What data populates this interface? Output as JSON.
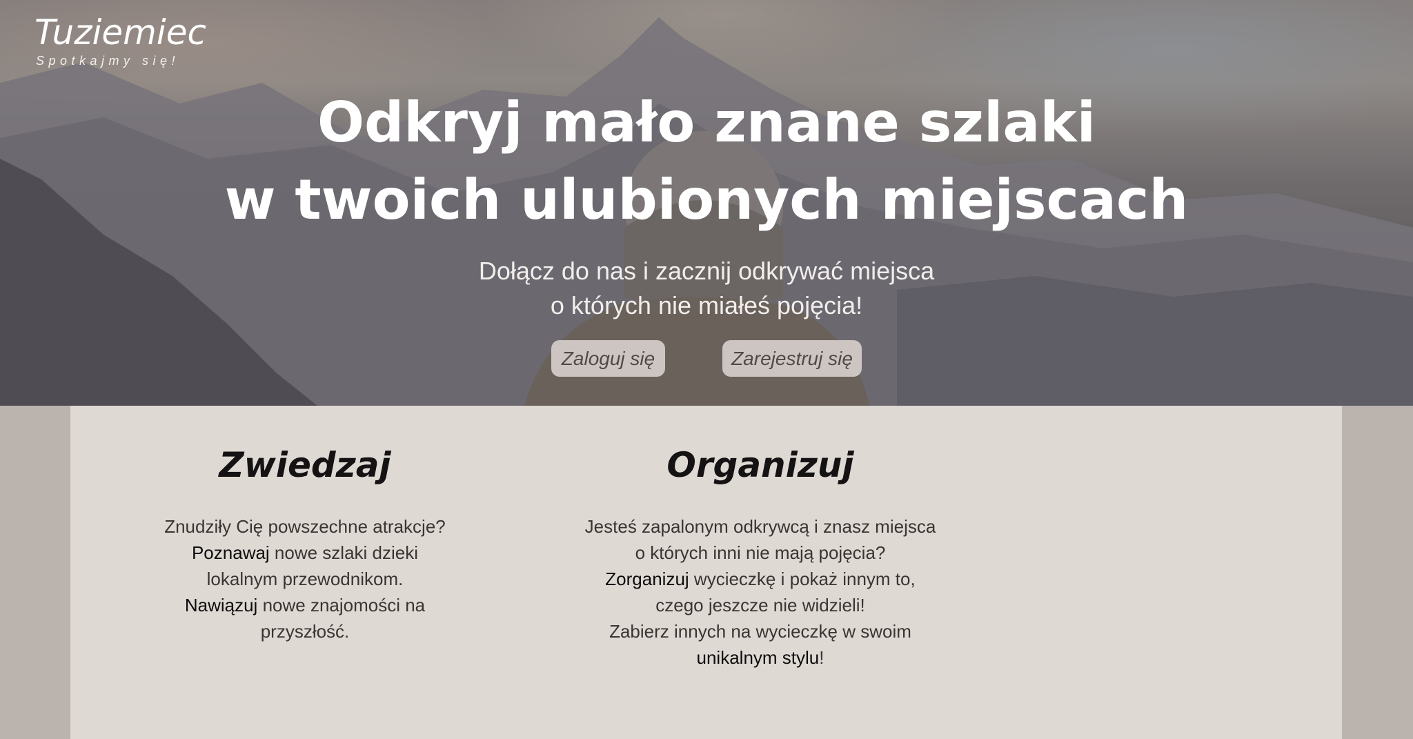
{
  "brand": {
    "title": "Tuziemiec",
    "tagline": "Spotkajmy się!"
  },
  "hero": {
    "heading_line1": "Odkryj mało znane szlaki",
    "heading_line2": "w twoich ulubionych miejscach",
    "subtitle_line1": "Dołącz do nas i zacznij odkrywać miejsca",
    "subtitle_line2": "o których nie miałeś pojęcia!",
    "login_label": "Zaloguj się",
    "register_label": "Zarejestruj się"
  },
  "explore": {
    "title": "Zwiedzaj",
    "line1": "Znudziły Cię powszechne atrakcje?",
    "line2_bold": "Poznawaj",
    "line2_rest": " nowe szlaki dzieki",
    "line3": "lokalnym przewodnikom.",
    "line4_bold": "Nawiązuj",
    "line4_rest": " nowe znajomości na",
    "line5": "przyszłość."
  },
  "organize": {
    "title": "Organizuj",
    "line1": "Jesteś zapalonym odkrywcą i znasz miejsca",
    "line2": "o których inni nie mają pojęcia?",
    "line3_bold": "Zorganizuj",
    "line3_rest": " wycieczkę i pokaż innym to,",
    "line4": "czego jeszcze nie widzieli!",
    "line5": "Zabierz innych na wycieczkę w swoim",
    "line6_bold": "unikalnym stylu",
    "line6_rest": "!"
  },
  "colors": {
    "hero_overlay": "#6f6b6d",
    "button_bg": "#cdc5c1",
    "content_bg": "#dfd9d4",
    "page_bg": "#bbb3ae"
  }
}
